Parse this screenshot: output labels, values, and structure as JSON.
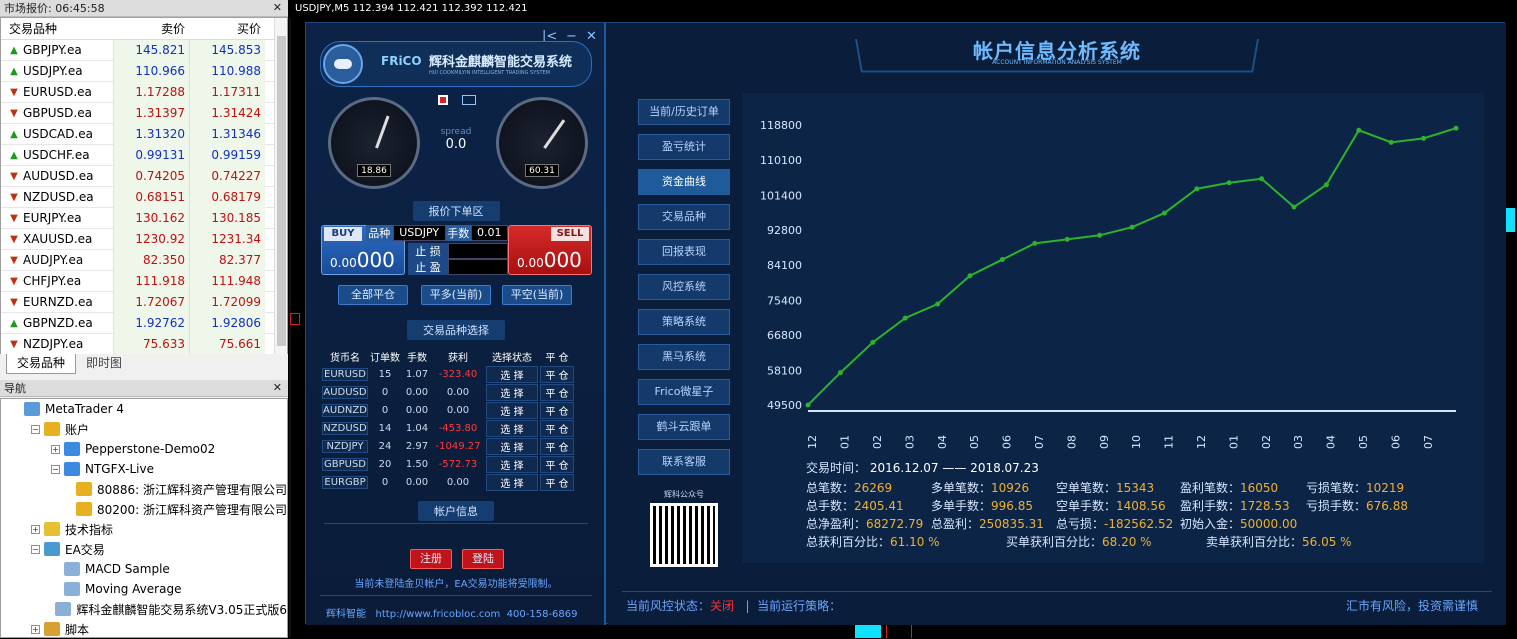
{
  "market": {
    "title": "市场报价: 06:45:58",
    "col_symbol": "交易品种",
    "col_bid": "卖价",
    "col_ask": "买价",
    "rows": [
      {
        "sym": "GBPJPY.ea",
        "bid": "145.821",
        "ask": "145.853",
        "dir": "up",
        "color": "blue"
      },
      {
        "sym": "USDJPY.ea",
        "bid": "110.966",
        "ask": "110.988",
        "dir": "up",
        "color": "blue"
      },
      {
        "sym": "EURUSD.ea",
        "bid": "1.17288",
        "ask": "1.17311",
        "dir": "down",
        "color": "red"
      },
      {
        "sym": "GBPUSD.ea",
        "bid": "1.31397",
        "ask": "1.31424",
        "dir": "down",
        "color": "red"
      },
      {
        "sym": "USDCAD.ea",
        "bid": "1.31320",
        "ask": "1.31346",
        "dir": "up",
        "color": "blue"
      },
      {
        "sym": "USDCHF.ea",
        "bid": "0.99131",
        "ask": "0.99159",
        "dir": "up",
        "color": "blue"
      },
      {
        "sym": "AUDUSD.ea",
        "bid": "0.74205",
        "ask": "0.74227",
        "dir": "down",
        "color": "red"
      },
      {
        "sym": "NZDUSD.ea",
        "bid": "0.68151",
        "ask": "0.68179",
        "dir": "down",
        "color": "red"
      },
      {
        "sym": "EURJPY.ea",
        "bid": "130.162",
        "ask": "130.185",
        "dir": "down",
        "color": "red"
      },
      {
        "sym": "XAUUSD.ea",
        "bid": "1230.92",
        "ask": "1231.34",
        "dir": "down",
        "color": "red"
      },
      {
        "sym": "AUDJPY.ea",
        "bid": "82.350",
        "ask": "82.377",
        "dir": "down",
        "color": "red"
      },
      {
        "sym": "CHFJPY.ea",
        "bid": "111.918",
        "ask": "111.948",
        "dir": "down",
        "color": "red"
      },
      {
        "sym": "EURNZD.ea",
        "bid": "1.72067",
        "ask": "1.72099",
        "dir": "down",
        "color": "red"
      },
      {
        "sym": "GBPNZD.ea",
        "bid": "1.92762",
        "ask": "1.92806",
        "dir": "up",
        "color": "blue"
      },
      {
        "sym": "NZDJPY.ea",
        "bid": "75.633",
        "ask": "75.661",
        "dir": "down",
        "color": "red"
      }
    ],
    "tabs": [
      "交易品种",
      "即时图"
    ]
  },
  "nav": {
    "title": "导航",
    "items": [
      {
        "label": "MetaTrader 4",
        "level": 0,
        "icon": "mt4-icon",
        "box": ""
      },
      {
        "label": "账户",
        "level": 1,
        "icon": "accounts-icon",
        "box": "−"
      },
      {
        "label": "Pepperstone-Demo02",
        "level": 2,
        "icon": "server-icon",
        "box": "+"
      },
      {
        "label": "NTGFX-Live",
        "level": 2,
        "icon": "server-icon",
        "box": "−"
      },
      {
        "label": "80886: 浙江辉科资产管理有限公司",
        "level": 3,
        "icon": "user-icon",
        "box": ""
      },
      {
        "label": "80200: 浙江辉科资产管理有限公司",
        "level": 3,
        "icon": "user-icon",
        "box": ""
      },
      {
        "label": "技术指标",
        "level": 1,
        "icon": "indicator-icon",
        "box": "+"
      },
      {
        "label": "EA交易",
        "level": 1,
        "icon": "ea-icon",
        "box": "−"
      },
      {
        "label": "MACD Sample",
        "level": 2,
        "icon": "expert-icon",
        "box": ""
      },
      {
        "label": "Moving Average",
        "level": 2,
        "icon": "expert-icon",
        "box": ""
      },
      {
        "label": "辉科金麒麟智能交易系统V3.05正式版6",
        "level": 2,
        "icon": "expert-icon",
        "box": ""
      },
      {
        "label": "脚本",
        "level": 1,
        "icon": "script-icon",
        "box": "+"
      }
    ]
  },
  "chartbar": "USDJPY,M5  112.394 112.421 112.392 112.421",
  "panel": {
    "brand": "FRiCO",
    "brand_cn": "辉科金麒麟智能交易系统",
    "brand_en": "HUI COOKMILYIN INTELLIGENT TRADING SYSTEM",
    "gauge_left": "18.86",
    "gauge_right": "60.31",
    "spread_label": "spread",
    "spread_value": "0.0",
    "order_section": "报价下单区",
    "buy": "BUY",
    "sell": "SELL",
    "sym_label": "品种",
    "sym_value": "USDJPY",
    "lot_label": "手数",
    "lot_value": "0.01",
    "sl_label": "止 损",
    "tp_label": "止 盈",
    "buy_price_small": "0.00",
    "buy_price_big": "000",
    "sell_price_small": "0.00",
    "sell_price_big": "000",
    "close_all": "全部平仓",
    "close_buy": "平多(当前)",
    "close_sell": "平空(当前)",
    "select_section": "交易品种选择",
    "table_headers": [
      "货币名",
      "订单数",
      "手数",
      "获利",
      "选择状态",
      "平 仓"
    ],
    "table_rows": [
      {
        "sym": "EURUSD",
        "orders": "15",
        "lots": "1.07",
        "profit": "-323.40"
      },
      {
        "sym": "AUDUSD",
        "orders": "0",
        "lots": "0.00",
        "profit": "0.00"
      },
      {
        "sym": "AUDNZD",
        "orders": "0",
        "lots": "0.00",
        "profit": "0.00"
      },
      {
        "sym": "NZDUSD",
        "orders": "14",
        "lots": "1.04",
        "profit": "-453.80"
      },
      {
        "sym": "NZDJPY",
        "orders": "24",
        "lots": "2.97",
        "profit": "-1049.27"
      },
      {
        "sym": "GBPUSD",
        "orders": "20",
        "lots": "1.50",
        "profit": "-572.73"
      },
      {
        "sym": "EURGBP",
        "orders": "0",
        "lots": "0.00",
        "profit": "0.00"
      }
    ],
    "select_btn": "选 择",
    "close_btn": "平 仓",
    "account_section": "帐户信息",
    "register": "注册",
    "login": "登陆",
    "notice": "当前未登陆金贝帐户，EA交易功能将受限制。",
    "footer_brand": "辉科智能",
    "footer_url": "http://www.fricobloc.com",
    "footer_phone": "400-158-6869"
  },
  "main": {
    "title": "帐户信息分析系统",
    "subtitle": "ACCOUNT INFORMATION ANALYSIS SYSTEM",
    "side_items": [
      "当前/历史订单",
      "盈亏统计",
      "资金曲线",
      "交易品种",
      "回报表现",
      "风控系统",
      "策略系统",
      "黑马系统",
      "Frico微星子",
      "鹤斗云跟单",
      "联系客服"
    ],
    "active_side": 2,
    "wechat_label": "辉科公众号",
    "period_label": "交易时间：",
    "period_value": "2016.12.07 —— 2018.07.23",
    "stats": [
      [
        {
          "k": "总笔数：",
          "v": "26269"
        },
        {
          "k": "多单笔数：",
          "v": "10926"
        },
        {
          "k": "空单笔数：",
          "v": "15343"
        },
        {
          "k": "盈利笔数：",
          "v": "16050"
        },
        {
          "k": "亏损笔数：",
          "v": "10219"
        }
      ],
      [
        {
          "k": "总手数：",
          "v": "2405.41"
        },
        {
          "k": "多单手数：",
          "v": "996.85"
        },
        {
          "k": "空单手数：",
          "v": "1408.56"
        },
        {
          "k": "盈利手数：",
          "v": "1728.53"
        },
        {
          "k": "亏损手数：",
          "v": "676.88"
        }
      ],
      [
        {
          "k": "总净盈利：",
          "v": "68272.79"
        },
        {
          "k": "总盈利：",
          "v": "250835.31"
        },
        {
          "k": "总亏损：",
          "v": "-182562.52"
        },
        {
          "k": "初始入金：",
          "v": "50000.00"
        }
      ],
      [
        {
          "k": "总获利百分比：",
          "v": "61.10 %"
        },
        {
          "k": "买单获利百分比：",
          "v": "68.20 %"
        },
        {
          "k": "卖单获利百分比：",
          "v": "56.05 %"
        }
      ]
    ],
    "risk_label": "当前风控状态：",
    "risk_value": "关闭",
    "strategy_label": "当前运行策略：",
    "disclaimer": "汇市有风险，投资需谨慎"
  },
  "chart_data": {
    "type": "line",
    "x": [
      "12",
      "01",
      "02",
      "03",
      "04",
      "05",
      "06",
      "07",
      "08",
      "09",
      "10",
      "11",
      "12",
      "01",
      "02",
      "03",
      "04",
      "05",
      "06",
      "07"
    ],
    "values": [
      49500,
      57500,
      65000,
      71000,
      74500,
      81500,
      85500,
      89500,
      90500,
      91500,
      93500,
      97000,
      103000,
      104500,
      105500,
      98500,
      104000,
      117500,
      114500,
      115500,
      118000
    ],
    "yticks": [
      118800,
      110100,
      101400,
      92800,
      84100,
      75400,
      66800,
      58100,
      49500
    ],
    "ylim": [
      49500,
      118800
    ],
    "line_color": "#2db22d"
  }
}
